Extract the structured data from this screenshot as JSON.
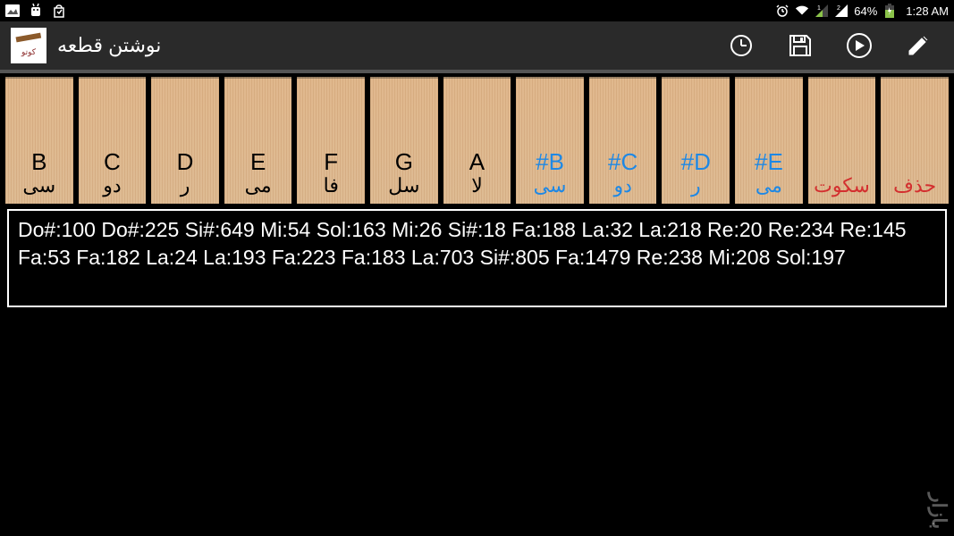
{
  "status": {
    "battery": "64%",
    "time": "1:28 AM"
  },
  "app": {
    "title": "نوشتن قطعه"
  },
  "keys": [
    {
      "top": "B",
      "sub": "سی",
      "style": "normal"
    },
    {
      "top": "C",
      "sub": "دو",
      "style": "normal"
    },
    {
      "top": "D",
      "sub": "ر",
      "style": "normal"
    },
    {
      "top": "E",
      "sub": "می",
      "style": "normal"
    },
    {
      "top": "F",
      "sub": "فا",
      "style": "normal"
    },
    {
      "top": "G",
      "sub": "سل",
      "style": "normal"
    },
    {
      "top": "A",
      "sub": "لا",
      "style": "normal"
    },
    {
      "top": "#B",
      "sub": "سی",
      "style": "sharp"
    },
    {
      "top": "#C",
      "sub": "دو",
      "style": "sharp"
    },
    {
      "top": "#D",
      "sub": "ر",
      "style": "sharp"
    },
    {
      "top": "#E",
      "sub": "می",
      "style": "sharp"
    },
    {
      "top": "",
      "sub": "سکوت",
      "style": "red"
    },
    {
      "top": "",
      "sub": "حذف",
      "style": "red"
    }
  ],
  "notes": " Do#:100 Do#:225 Si#:649 Mi:54 Sol:163 Mi:26 Si#:18 Fa:188 La:32 La:218 Re:20 Re:234 Re:145 Fa:53 Fa:182 La:24 La:193 Fa:223 Fa:183 La:703 Si#:805 Fa:1479 Re:238 Mi:208 Sol:197",
  "watermark": "بازار"
}
